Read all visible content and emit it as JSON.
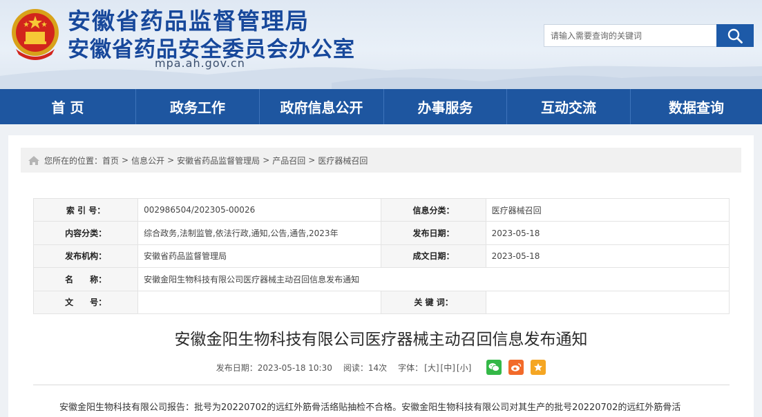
{
  "header": {
    "title_line1": "安徽省药品监督管理局",
    "title_line2": "安徽省药品安全委员会办公室",
    "domain": "mpa.ah.gov.cn",
    "emblem_icon": "national-emblem-icon"
  },
  "search": {
    "placeholder": "请输入需要查询的关键词",
    "value": "",
    "button_icon": "search-icon"
  },
  "nav": {
    "items": [
      {
        "label": "首 页"
      },
      {
        "label": "政务工作"
      },
      {
        "label": "政府信息公开"
      },
      {
        "label": "办事服务"
      },
      {
        "label": "互动交流"
      },
      {
        "label": "数据查询"
      }
    ]
  },
  "breadcrumb": {
    "prefix": "您所在的位置：",
    "items": [
      "首页",
      "信息公开",
      "安徽省药品监督管理局",
      "产品召回",
      "医疗器械召回"
    ],
    "separator": ">"
  },
  "meta": {
    "index_label": "索 引 号：",
    "index_value": "002986504/202305-00026",
    "info_class_label": "信息分类：",
    "info_class_value": "医疗器械召回",
    "content_class_label": "内容分类：",
    "content_class_value": "综合政务,法制监管,依法行政,通知,公告,通告,2023年",
    "publish_date_label": "发布日期：",
    "publish_date_value": "2023-05-18",
    "publisher_label": "发布机构：",
    "publisher_value": "安徽省药品监督管理局",
    "created_date_label": "成文日期：",
    "created_date_value": "2023-05-18",
    "name_label": "名　　称：",
    "name_value": "安徽金阳生物科技有限公司医疗器械主动召回信息发布通知",
    "doc_no_label": "文　　号：",
    "doc_no_value": "",
    "keywords_label": "关 键 词：",
    "keywords_value": ""
  },
  "article": {
    "title": "安徽金阳生物科技有限公司医疗器械主动召回信息发布通知",
    "publish_info": "发布日期：2023-05-18 10:30",
    "views": "阅读：14次",
    "font_label": "字体：",
    "font_large": "[大]",
    "font_medium": "[中]",
    "font_small": "[小]",
    "body_first_line": "安徽金阳生物科技有限公司报告：批号为20220702的远红外筋骨活络贴抽检不合格。安徽金阳生物科技有限公司对其生产的批号20220702的远红外筋骨活"
  },
  "colors": {
    "brand_blue": "#17489b",
    "nav_blue": "#1e56a0",
    "wechat_green": "#34b847",
    "weibo_orange": "#f26a2a",
    "favorite_yellow": "#f5a623"
  }
}
